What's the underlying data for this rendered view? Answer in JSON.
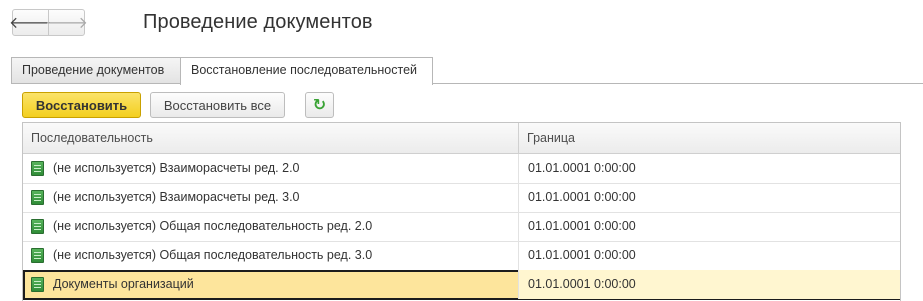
{
  "window": {
    "title": "Проведение документов",
    "back_icon": "arrow-left-icon",
    "forward_icon": "arrow-right-icon",
    "back_glyph": "🡐",
    "forward_glyph": "🡒"
  },
  "tabs": [
    {
      "label": "Проведение документов",
      "active": false
    },
    {
      "label": "Восстановление последовательностей",
      "active": true
    }
  ],
  "toolbar": {
    "restore_label": "Восстановить",
    "restore_all_label": "Восстановить все",
    "refresh_icon": "refresh-icon",
    "refresh_glyph": "↻"
  },
  "table": {
    "columns": [
      "Последовательность",
      "Граница"
    ],
    "rows": [
      {
        "name": "(не используется) Взаиморасчеты ред. 2.0",
        "border": "01.01.0001 0:00:00",
        "icon": "document-register-icon"
      },
      {
        "name": "(не используется) Взаиморасчеты ред. 3.0",
        "border": "01.01.0001 0:00:00",
        "icon": "document-register-icon"
      },
      {
        "name": "(не используется) Общая последовательность ред. 2.0",
        "border": "01.01.0001 0:00:00",
        "icon": "document-register-icon"
      },
      {
        "name": "(не используется) Общая последовательность ред. 3.0",
        "border": "01.01.0001 0:00:00",
        "icon": "document-register-icon"
      },
      {
        "name": "Документы организаций",
        "border": "01.01.0001 0:00:00",
        "icon": "document-register-icon",
        "selected": true
      }
    ]
  },
  "colors": {
    "primary_button": "#f3cf1f",
    "selected_row": "#fde59c",
    "refresh_icon": "#3aa335"
  }
}
